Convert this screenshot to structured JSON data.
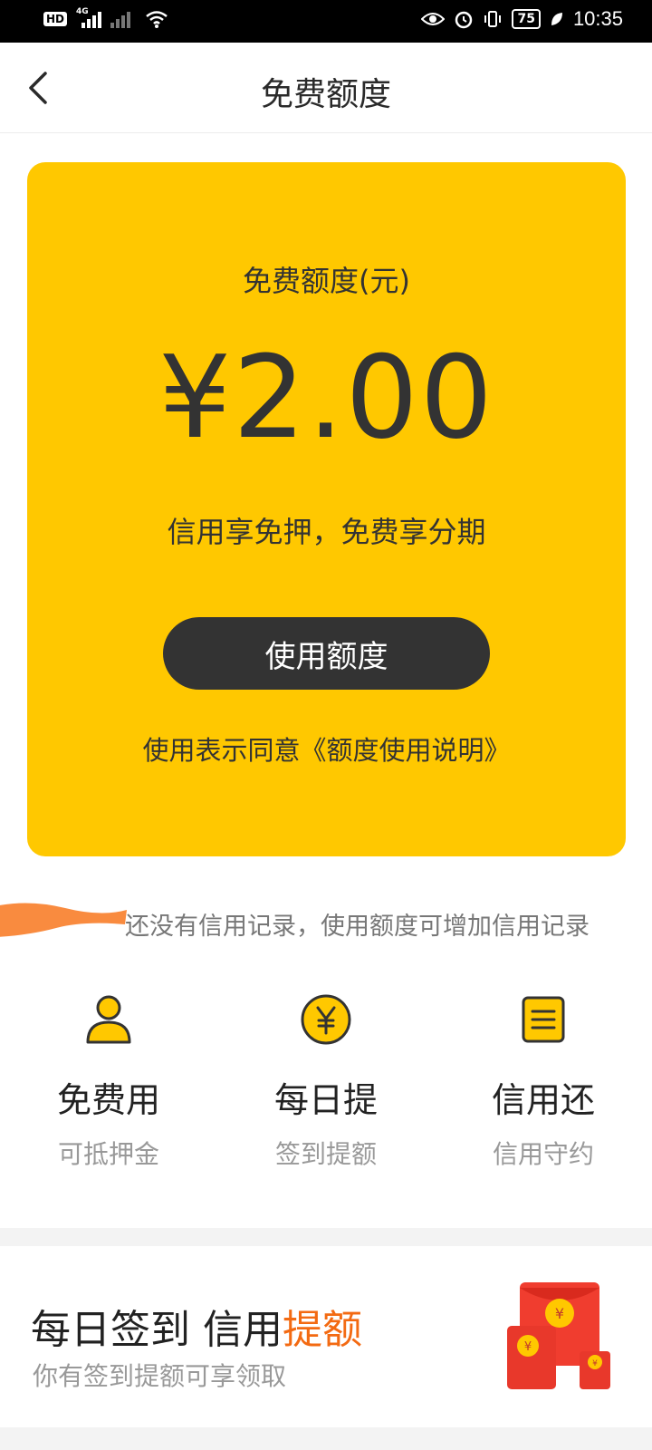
{
  "status_bar": {
    "hd_badge": "HD",
    "network_type": "4G",
    "battery": "75",
    "time": "10:35"
  },
  "header": {
    "title": "免费额度"
  },
  "card": {
    "label": "免费额度(元)",
    "amount": "¥2.00",
    "slogan": "信用享免押，免费享分期",
    "button_label": "使用额度",
    "agreement_text": "使用表示同意《额度使用说明》"
  },
  "credit_note": {
    "text": "还没有信用记录，使用额度可增加信用记录"
  },
  "features": [
    {
      "icon": "user-icon",
      "title": "免费用",
      "subtitle": "可抵押金"
    },
    {
      "icon": "yuan-coin-icon",
      "title": "每日提",
      "subtitle": "签到提额"
    },
    {
      "icon": "document-icon",
      "title": "信用还",
      "subtitle": "信用守约"
    }
  ],
  "sign_banner": {
    "title_part1": "每日签到 信用",
    "title_highlight": "提额",
    "subtitle": "你有签到提额可享领取"
  },
  "colors": {
    "accent_yellow": "#ffc800",
    "dark": "#333333",
    "highlight_orange": "#f36a12",
    "muted_text": "#999999",
    "redpack_red": "#f03d2f"
  }
}
